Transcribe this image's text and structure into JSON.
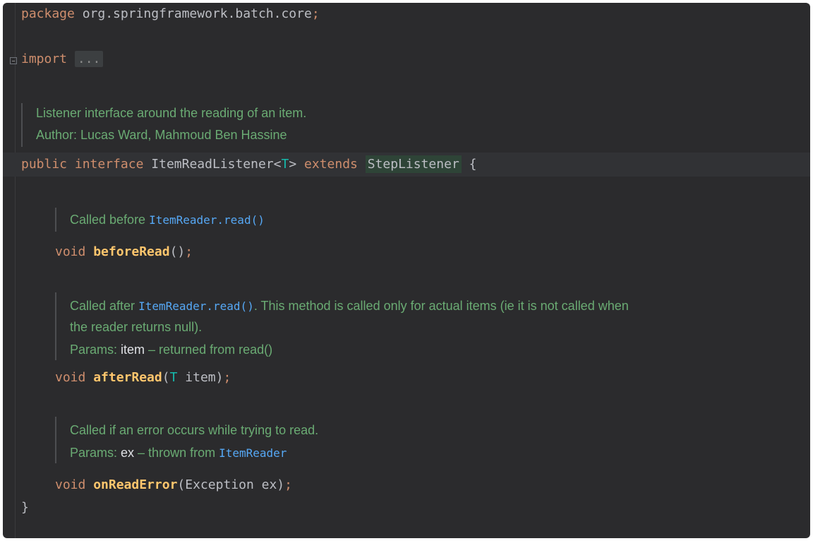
{
  "code": {
    "package_kw": "package",
    "package_name": " org.springframework.batch.core",
    "semicolon": ";",
    "import_kw": "import",
    "import_fold": "...",
    "class_doc_line1": "Listener interface around the reading of an item.",
    "class_doc_line2": "Author: Lucas Ward, Mahmoud Ben Hassine",
    "public_kw": "public",
    "interface_kw": "interface",
    "iface_name": "ItemReadListener",
    "lt": "<",
    "type_param": "T",
    "gt": ">",
    "extends_kw": "extends",
    "super_name": "StepListener",
    "open_brace": " {",
    "before_doc_prefix": "Called before ",
    "before_doc_link": "ItemReader.read()",
    "void_kw": "void",
    "before_name": "beforeRead",
    "before_parens": "()",
    "after_doc_prefix": "Called after ",
    "after_doc_link": "ItemReader.read()",
    "after_doc_rest": ". This method is called only for actual items (ie it is not called when",
    "after_doc_line2": "the reader returns null).",
    "after_params_label": "Params: ",
    "after_params_name": "item",
    "after_params_desc": " – returned from read()",
    "after_name": "afterRead",
    "after_paren_open": "(",
    "after_param_type": "T",
    "after_param_rest": " item)",
    "error_doc_line1": "Called if an error occurs while trying to read.",
    "error_params_label": "Params: ",
    "error_params_name": "ex",
    "error_params_desc": " – thrown from ",
    "error_params_link": "ItemReader",
    "error_name": "onReadError",
    "error_params": "(Exception ex)",
    "close_brace": "}"
  },
  "colors": {
    "background": "#2b2b2d",
    "keyword": "#cf8e6d",
    "method": "#ffc66d",
    "doc": "#6aab73",
    "link": "#56a8f5",
    "type_param": "#16baac"
  }
}
